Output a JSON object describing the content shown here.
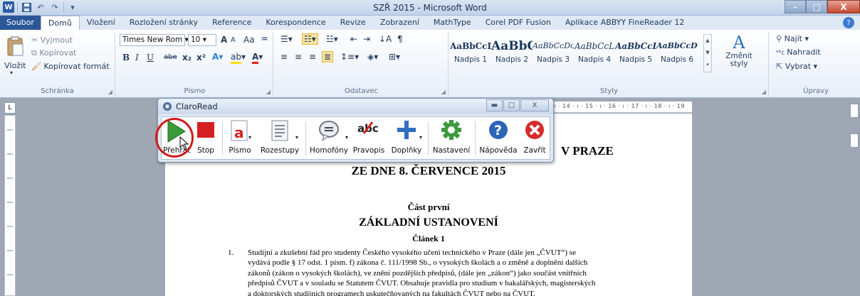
{
  "window": {
    "title": "SZŘ 2015 - Microsoft Word",
    "logo_letter": "W",
    "controls": {
      "minimize": "–",
      "maximize": "□",
      "close": "X"
    }
  },
  "quick_access": {
    "save_icon": "save-icon",
    "undo": "↶",
    "redo": "↷",
    "customize": "▾"
  },
  "tabs": [
    {
      "label": "Soubor"
    },
    {
      "label": "Domů"
    },
    {
      "label": "Vložení"
    },
    {
      "label": "Rozložení stránky"
    },
    {
      "label": "Reference"
    },
    {
      "label": "Korespondence"
    },
    {
      "label": "Revize"
    },
    {
      "label": "Zobrazení"
    },
    {
      "label": "MathType"
    },
    {
      "label": "Corel PDF Fusion"
    },
    {
      "label": "Aplikace ABBYY FineReader 12"
    }
  ],
  "ribbon": {
    "clipboard": {
      "paste": "Vložit",
      "cut": "Vyjmout",
      "copy": "Kopírovat",
      "format_painter": "Kopírovat formát",
      "label": "Schránka"
    },
    "font": {
      "font_name": "Times New Rom",
      "font_size": "10",
      "grow": "A",
      "shrink": "A",
      "case": "Aa",
      "bold": "B",
      "italic": "I",
      "underline": "U",
      "strike": "abe",
      "subscript": "x₂",
      "superscript": "x²",
      "label": "Písmo"
    },
    "paragraph": {
      "label": "Odstavec"
    },
    "styles": {
      "items": [
        {
          "sample": "AaBbCcDd",
          "name": "Nadpis 1"
        },
        {
          "sample": "AaBbC",
          "name": "Nadpis 2"
        },
        {
          "sample": "AaBbCcDc",
          "name": "Nadpis 3"
        },
        {
          "sample": "AaBbCcL",
          "name": "Nadpis 4"
        },
        {
          "sample": "AaBbCcL",
          "name": "Nadpis 5"
        },
        {
          "sample": "AaBbCcDc",
          "name": "Nadpis 6"
        }
      ],
      "change_styles": "Změnit styly",
      "label": "Styly"
    },
    "editing": {
      "find": "Najít",
      "replace": "Nahradit",
      "select": "Vybrat",
      "label": "Úpravy"
    }
  },
  "ruler": {
    "corner": "L",
    "marks": "13 · ı · 14 · ı · 15 · ı · 16 · ı · 17 · ı · 18 · ı · 19"
  },
  "claroread": {
    "title": "ClaroRead",
    "tools": [
      {
        "label": "Přehrát",
        "icon": "play-icon"
      },
      {
        "label": "Stop",
        "icon": "stop-icon"
      },
      {
        "label": "Písmo",
        "icon": "font-icon"
      },
      {
        "label": "Rozestupy",
        "icon": "spacing-icon"
      },
      {
        "label": "Homofóny",
        "icon": "homophones-icon"
      },
      {
        "label": "Pravopis",
        "icon": "spellcheck-icon"
      },
      {
        "label": "Doplňky",
        "icon": "plus-icon"
      },
      {
        "label": "Nastavení",
        "icon": "gear-icon"
      },
      {
        "label": "Nápověda",
        "icon": "help-icon"
      },
      {
        "label": "Zavřít",
        "icon": "close-icon"
      }
    ]
  },
  "document": {
    "title_line1": "V PRAZE",
    "title_line2": "ZE DNE 8. ČERVENCE 2015",
    "part": "Část první",
    "heading": "ZÁKLADNÍ USTANOVENÍ",
    "article": "Článek 1",
    "item_number": "1.",
    "paragraph_lines": [
      "Studijní a zkušební řád pro studenty Českého vysokého učení technického v Praze (dále jen „ČVUT“) se",
      "vydává podle § 17 odst. 1 písm. f) zákona č. 111/1998 Sb., o vysokých školách a o změně a doplnění dalších",
      "zákonů (zákon o vysokých školách), ve znění pozdějších předpisů, (dále jen „zákon“) jako součást vnitřních",
      "předpisů ČVUT a v souladu se Statutem ČVUT. Obsahuje pravidla pro studium v bakalářských, magisterských",
      "a doktorských studijních programech uskutečňovaných na fakultách ČVUT nebo na ČVUT."
    ]
  }
}
